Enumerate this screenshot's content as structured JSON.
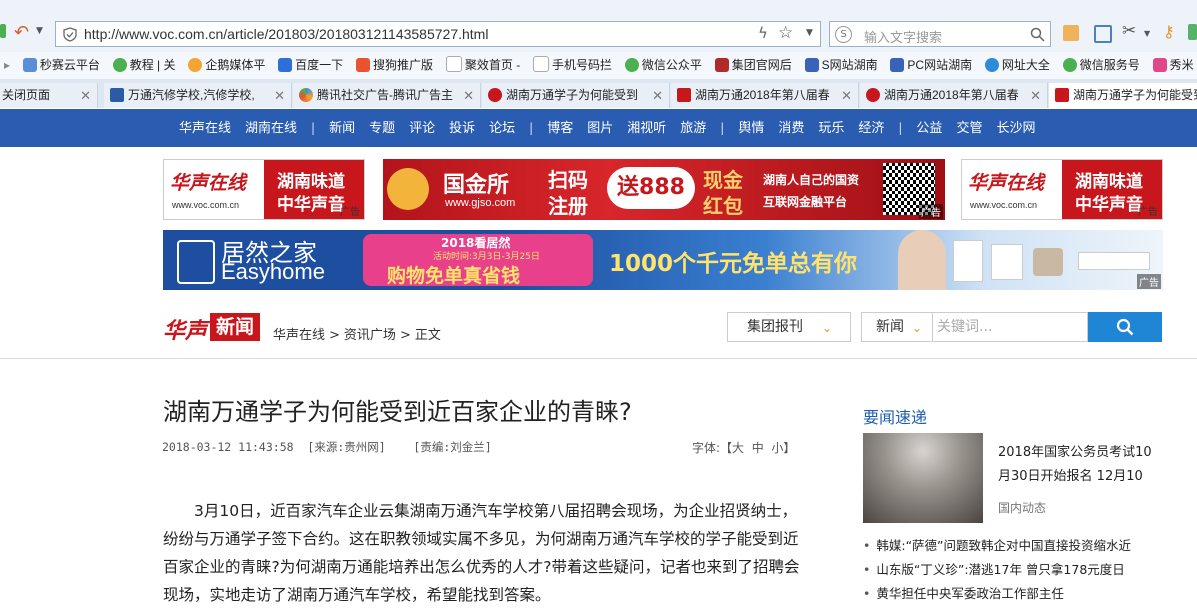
{
  "browser": {
    "url": "http://www.voc.com.cn/article/201803/201803121143585727.html",
    "search_placeholder": "输入文字搜索",
    "bookmarks": [
      "秒赛云平台",
      "教程 | 关",
      "企鹅媒体平",
      "百度一下",
      "搜狗推广版",
      "聚效首页 -",
      "手机号码拦",
      "微信公众平",
      "集团官网后",
      "S网站湖南",
      "PC网站湖南",
      "网址大全",
      "微信服务号",
      "秀米"
    ],
    "tabs": [
      {
        "label": "关闭页面",
        "active": false
      },
      {
        "label": "万通汽修学校,汽修学校,",
        "active": false
      },
      {
        "label": "腾讯社交广告-腾讯广告主",
        "active": false
      },
      {
        "label": "湖南万通学子为何能受到",
        "active": false
      },
      {
        "label": "湖南万通2018年第八届春",
        "active": false
      },
      {
        "label": "湖南万通2018年第八届春",
        "active": false
      },
      {
        "label": "湖南万通学子为何能受到",
        "active": true
      }
    ]
  },
  "site_nav": {
    "group1": [
      "华声在线",
      "湖南在线"
    ],
    "group2": [
      "新闻",
      "专题",
      "评论",
      "投诉",
      "论坛"
    ],
    "group3": [
      "博客",
      "图片",
      "湘视听",
      "旅游"
    ],
    "group4": [
      "舆情",
      "消费",
      "玩乐",
      "经济"
    ],
    "group5": [
      "公益",
      "交管",
      "长沙网"
    ],
    "separator": "|"
  },
  "ads": {
    "left": {
      "brand": "华声在线",
      "url": "www.voc.com.cn",
      "slogan1": "湖南味道",
      "slogan2": "中华声音",
      "tag": "广告"
    },
    "center": {
      "brand": "国金所",
      "url": "www.gjso.com",
      "t1": "扫码",
      "t2": "注册",
      "badge": "送888",
      "t3": "现金",
      "t4": "红包",
      "t5": "湖南人自己的国资",
      "t6": "互联网金融平台",
      "tag": "广告"
    },
    "right": {
      "brand": "华声在线",
      "url": "www.voc.com.cn",
      "slogan1": "湖南味道",
      "slogan2": "中华声音",
      "tag": "广告"
    },
    "banner": {
      "brand_cn": "居然之家",
      "brand_en": "Easyhome",
      "line1": "2018看居然",
      "line2": "活动时间:3月3日-3月25日",
      "line3": "购物免单真省钱",
      "promo": "1000个千元免单总有你",
      "tag": "广告"
    }
  },
  "header": {
    "logo_a": "华声",
    "logo_b": "新闻",
    "breadcrumb": [
      "华声在线",
      "资讯广场",
      "正文"
    ],
    "crumb_sep": ">",
    "group_select": "集团报刊",
    "category_select": "新闻",
    "keyword_placeholder": "关键词..."
  },
  "article": {
    "title": "湖南万通学子为何能受到近百家企业的青睐?",
    "datetime": "2018-03-12 11:43:58",
    "source": "[来源:贵州网]",
    "editor": "[责编:刘金兰]",
    "font_label": "字体:【",
    "font_large": "大",
    "font_medium": "中",
    "font_small": "小",
    "font_end": "】",
    "body": "3月10日，近百家汽车企业云集湖南万通汽车学校第八届招聘会现场，为企业招贤纳士，纷纷与万通学子签下合约。这在职教领域实属不多见，为何湖南万通汽车学校的学子能受到近百家企业的青睐?为何湖南万通能培养出怎么优秀的人才?带着这些疑问，记者也来到了招聘会现场，实地走访了湖南万通汽车学校，希望能找到答案。"
  },
  "sidebar": {
    "title": "要闻速递",
    "headline": "2018年国家公务员考试10月30日开始报名 12月10",
    "category": "国内动态",
    "items": [
      "韩媒:“萨德”问题致韩企对中国直接投资缩水近",
      "山东版“丁义珍”:潜逃17年 曾只拿178元度日",
      "黄华担任中央军委政治工作部主任"
    ]
  },
  "colors": {
    "nav_blue": "#2a5db1",
    "accent_red": "#c8161d",
    "search_blue": "#1f86d6"
  }
}
